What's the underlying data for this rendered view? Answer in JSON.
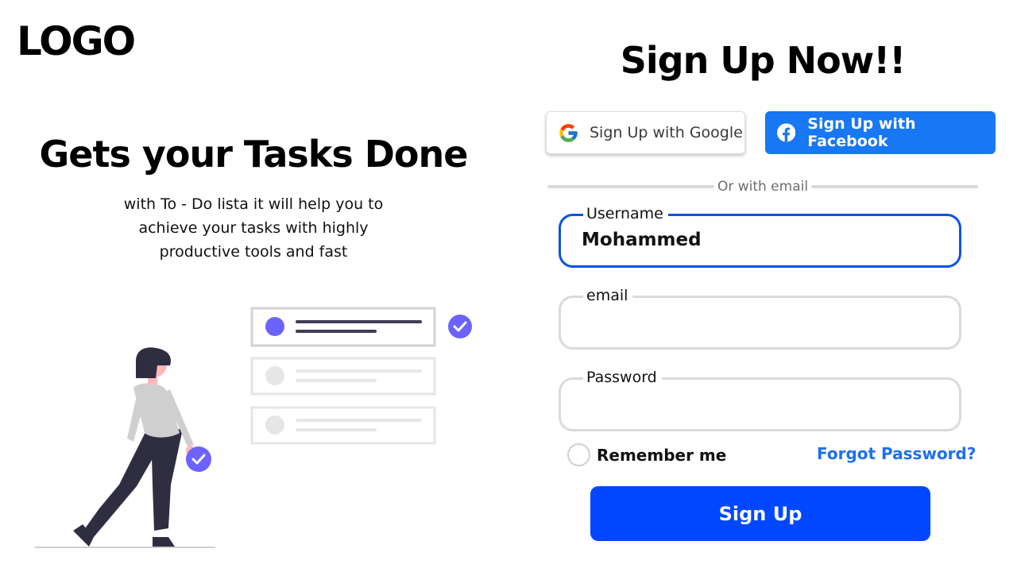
{
  "brand": {
    "logo_text": "LOGO"
  },
  "hero": {
    "title": "Gets your Tasks Done",
    "subtitle_lines": [
      "with To - Do lista it will help you to",
      "achieve your tasks with highly",
      "productive tools and fast"
    ]
  },
  "form": {
    "title": "Sign Up Now!!",
    "google_label": "Sign Up with Google",
    "facebook_label": "Sign Up with Facebook",
    "divider_text": "Or with email",
    "fields": [
      {
        "label": "Username",
        "value": "Mohammed"
      },
      {
        "label": "email",
        "value": ""
      },
      {
        "label": "Password",
        "value": ""
      }
    ],
    "remember_label": "Remember me",
    "forgot_label": "Forgot Password?",
    "submit_label": "Sign Up"
  },
  "colors": {
    "primary_blue": "#0047ff",
    "facebook_blue": "#1877f2",
    "link_blue": "#1e6ff0",
    "active_border": "#0b53e4",
    "accent_purple": "#6c63ff"
  },
  "icons": [
    "google-icon",
    "facebook-icon",
    "check-icon"
  ]
}
